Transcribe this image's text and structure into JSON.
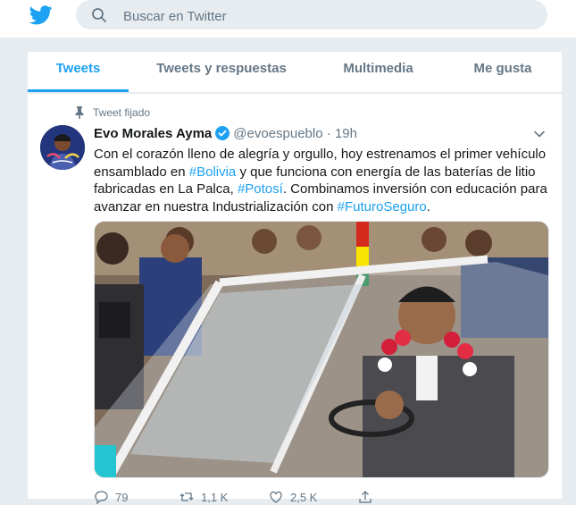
{
  "search": {
    "placeholder": "Buscar en Twitter"
  },
  "tabs": [
    {
      "label": "Tweets",
      "active": true
    },
    {
      "label": "Tweets y respuestas",
      "active": false
    },
    {
      "label": "Multimedia",
      "active": false
    },
    {
      "label": "Me gusta",
      "active": false
    }
  ],
  "tweet": {
    "pinned_label": "Tweet fijado",
    "author_name": "Evo Morales Ayma",
    "handle": "@evoespueblo",
    "separator": "·",
    "time": "19h",
    "text_parts": {
      "p1": "Con el corazón lleno de alegría y orgullo, hoy estrenamos el primer vehículo ensamblado en ",
      "h1": "#Bolivia",
      "p2": " y que funciona con energía de las baterías de litio fabricadas en La Palca, ",
      "h2": "#Potosí",
      "p3": ". Combinamos inversión con educación para avanzar en nuestra Industrialización con ",
      "h3": "#FuturoSeguro",
      "p4": "."
    },
    "actions": {
      "reply_count": "79",
      "retweet_count": "1,1 K",
      "like_count": "2,5 K"
    }
  },
  "colors": {
    "accent": "#1da1f2",
    "text": "#14171a",
    "secondary": "#657786",
    "background": "#e6ecf0"
  },
  "icons": [
    "twitter-bird-icon",
    "search-icon",
    "pin-icon",
    "verified-icon",
    "chevron-down-icon",
    "reply-icon",
    "retweet-icon",
    "like-icon",
    "share-icon"
  ]
}
